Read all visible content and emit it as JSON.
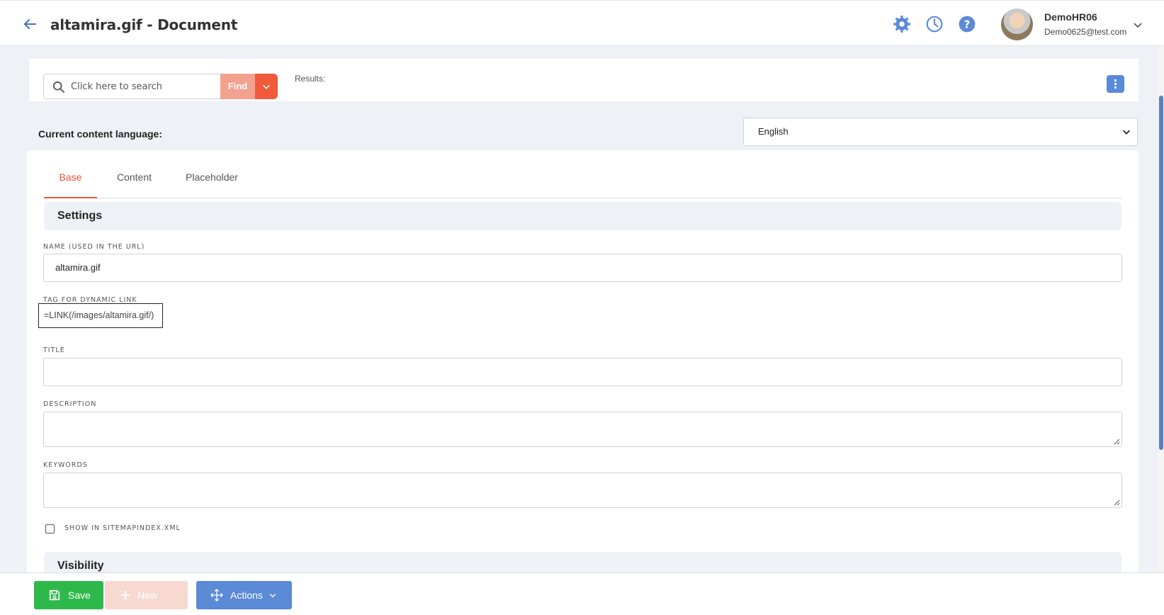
{
  "header": {
    "title": "altamira.gif - Document",
    "user_name": "DemoHR06",
    "user_email": "Demo0625@test.com",
    "icons": [
      "arrow-left-icon",
      "gear-icon",
      "clock-icon",
      "help-icon",
      "chevron-down-icon"
    ],
    "icon_color": "#5b8ad6"
  },
  "search": {
    "placeholder": "Click here to search",
    "value": "",
    "find_label": "Find",
    "results_label": "Results:"
  },
  "language": {
    "label": "Current content language:",
    "selected": "English"
  },
  "tabs": [
    {
      "label": "Base",
      "active": true
    },
    {
      "label": "Content",
      "active": false
    },
    {
      "label": "Placeholder",
      "active": false
    }
  ],
  "sections": {
    "settings": "Settings",
    "visibility": "Visibility"
  },
  "fields": {
    "name_label": "NAME (USED IN THE URL)",
    "name_value": "altamira.gif",
    "dynlink_label": "TAG FOR DYNAMIC LINK",
    "dynlink_value": "=LINK(/images/altamira.gif/)",
    "title_label": "TITLE",
    "title_value": "",
    "description_label": "DESCRIPTION",
    "description_value": "",
    "keywords_label": "KEYWORDS",
    "keywords_value": "",
    "sitemap_label": "SHOW IN SITEMAPINDEX.XML",
    "sitemap_checked": false
  },
  "toolbar": {
    "save_label": "Save",
    "new_label": "New",
    "actions_label": "Actions"
  },
  "colors": {
    "accent": "#e8553a",
    "save": "#2fb84a",
    "actions": "#5b8ad6",
    "find": "#f3a290"
  }
}
